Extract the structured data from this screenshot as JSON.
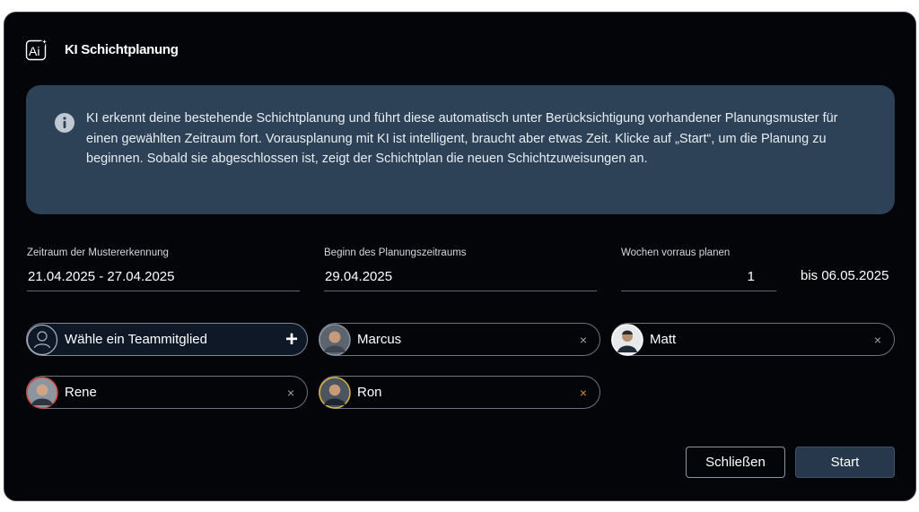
{
  "dialog": {
    "title": "KI Schichtplanung",
    "info_text": "KI erkennt deine bestehende Schichtplanung und führt diese automatisch unter Berücksichtigung vorhandener Planungsmuster für einen gewählten Zeitraum fort. Vorausplanung mit KI ist intelligent, braucht aber etwas Zeit. Klicke auf „Start“, um die Planung zu beginnen. Sobald sie abgeschlossen ist, zeigt der Schichtplan die neuen Schichtzuweisungen an."
  },
  "fields": {
    "pattern_range": {
      "label": "Zeitraum der Mustererkennung",
      "value": "21.04.2025 - 27.04.2025"
    },
    "planning_start": {
      "label": "Beginn des Planungszeitraums",
      "value": "29.04.2025"
    },
    "weeks": {
      "label": "Wochen vorraus planen",
      "value": "1"
    },
    "until_text": "bis 06.05.2025"
  },
  "team": {
    "add_placeholder": "Wähle ein Teammitglied",
    "add_icon": "+",
    "members": [
      {
        "name": "Marcus",
        "ring_color": "#8a929c"
      },
      {
        "name": "Matt",
        "ring_color": "#ffffff"
      },
      {
        "name": "Rene",
        "ring_color": "#d9483f"
      },
      {
        "name": "Ron",
        "ring_color": "#e0b43a"
      }
    ],
    "remove_symbol": "×"
  },
  "buttons": {
    "close": "Schließen",
    "start": "Start"
  },
  "colors": {
    "background": "#030508",
    "info_box": "#2d4157",
    "primary_button": "#27384c",
    "ron_remove": "#d68a3d"
  },
  "icons": [
    "ai-sparkle-icon",
    "info-icon",
    "person-outline-icon",
    "plus-icon",
    "close-icon",
    "avatar"
  ]
}
